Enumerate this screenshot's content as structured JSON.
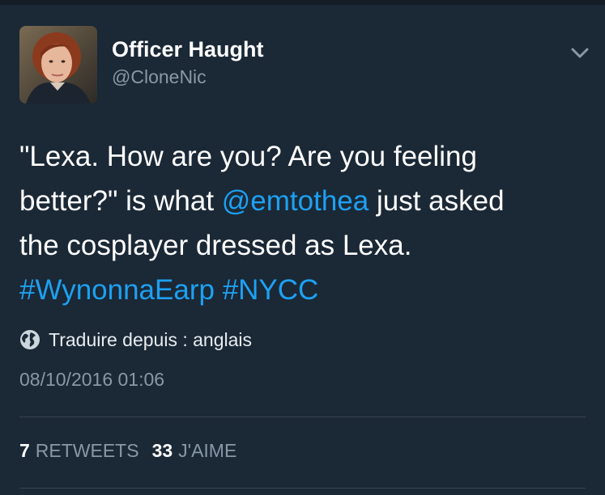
{
  "author": {
    "display_name": "Officer Haught",
    "handle": "@CloneNic",
    "avatar_icon": "profile-photo"
  },
  "tweet": {
    "line1": "\"Lexa. How are you? Are you feeling",
    "line2_before": "better?\" is what ",
    "mention": "@emtothea",
    "line2_after": " just asked",
    "line3": "the cosplayer dressed as Lexa.",
    "hashtag1": "#WynonnaEarp",
    "hashtag2": "#NYCC"
  },
  "translate": {
    "label": "Traduire depuis : anglais",
    "icon": "globe-icon"
  },
  "timestamp": "08/10/2016 01:06",
  "stats": {
    "retweets_count": "7",
    "retweets_label": "RETWEETS",
    "likes_count": "33",
    "likes_label": "J'AIME"
  },
  "colors": {
    "background": "#1b2836",
    "link": "#1da1f2",
    "secondary_text": "#8899a6",
    "divider": "#38444d"
  }
}
